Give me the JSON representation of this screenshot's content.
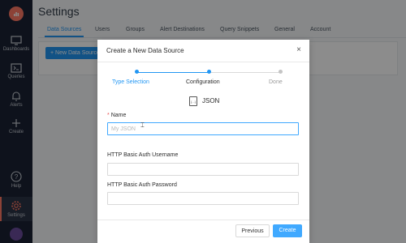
{
  "sidebar": {
    "items": [
      {
        "label": "Dashboards",
        "icon": "monitor-icon"
      },
      {
        "label": "Queries",
        "icon": "terminal-icon"
      },
      {
        "label": "Alerts",
        "icon": "bell-icon"
      },
      {
        "label": "Create",
        "icon": "plus-icon"
      },
      {
        "label": "Help",
        "icon": "help-icon"
      },
      {
        "label": "Settings",
        "icon": "gear-icon"
      }
    ]
  },
  "page": {
    "title": "Settings",
    "tabs": [
      "Data Sources",
      "Users",
      "Groups",
      "Alert Destinations",
      "Query Snippets",
      "General",
      "Account"
    ],
    "new_button": "+ New Data Source"
  },
  "modal": {
    "title": "Create a New Data Source",
    "close": "×",
    "steps": [
      "Type Selection",
      "Configuration",
      "Done"
    ],
    "type_name": "JSON",
    "type_icon_text": "{...}",
    "fields": [
      {
        "label": "Name",
        "required": true,
        "placeholder": "My JSON",
        "value": ""
      },
      {
        "label": "HTTP Basic Auth Username",
        "required": false,
        "placeholder": "",
        "value": ""
      },
      {
        "label": "HTTP Basic Auth Password",
        "required": false,
        "placeholder": "",
        "value": ""
      }
    ],
    "buttons": {
      "previous": "Previous",
      "create": "Create"
    }
  },
  "colors": {
    "accent": "#2196f3",
    "sidebar": "#1a2233",
    "brand": "#ff7964"
  }
}
